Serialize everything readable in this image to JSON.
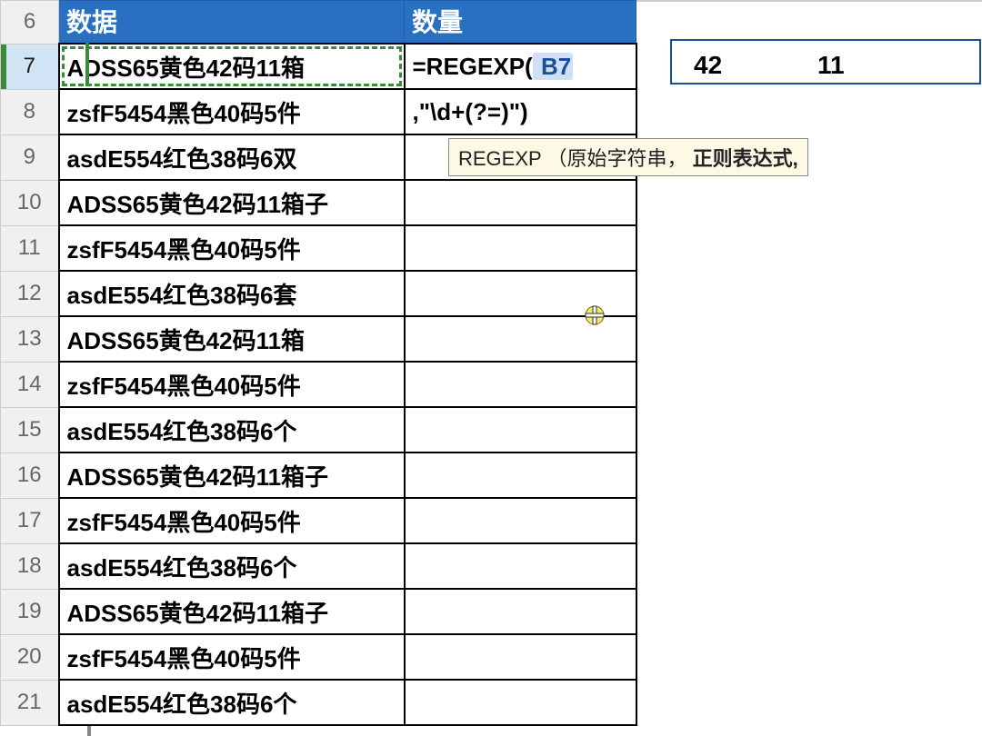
{
  "headers": {
    "data": "数据",
    "qty": "数量"
  },
  "rows": [
    {
      "n": "6",
      "b": ""
    },
    {
      "n": "7",
      "b": "ADSS65黄色42码11箱"
    },
    {
      "n": "8",
      "b": "zsfF5454黑色40码5件"
    },
    {
      "n": "9",
      "b": "asdE554红色38码6双"
    },
    {
      "n": "10",
      "b": "ADSS65黄色42码11箱子"
    },
    {
      "n": "11",
      "b": "zsfF5454黑色40码5件"
    },
    {
      "n": "12",
      "b": "asdE554红色38码6套"
    },
    {
      "n": "13",
      "b": "ADSS65黄色42码11箱"
    },
    {
      "n": "14",
      "b": "zsfF5454黑色40码5件"
    },
    {
      "n": "15",
      "b": "asdE554红色38码6个"
    },
    {
      "n": "16",
      "b": "ADSS65黄色42码11箱子"
    },
    {
      "n": "17",
      "b": "zsfF5454黑色40码5件"
    },
    {
      "n": "18",
      "b": "asdE554红色38码6个"
    },
    {
      "n": "19",
      "b": "ADSS65黄色42码11箱子"
    },
    {
      "n": "20",
      "b": "zsfF5454黑色40码5件"
    },
    {
      "n": "21",
      "b": "asdE554红色38码6个"
    }
  ],
  "formula": {
    "pre": "=REGEXP(",
    "ref": " B7 ",
    "line2": ",\"\\d+(?=)\")"
  },
  "results": {
    "d7": "42",
    "e7": "11"
  },
  "tooltip": {
    "fn": "REGEXP",
    "args": "（原始字符串，",
    "bold": "正则表达式,",
    "tail": ""
  }
}
